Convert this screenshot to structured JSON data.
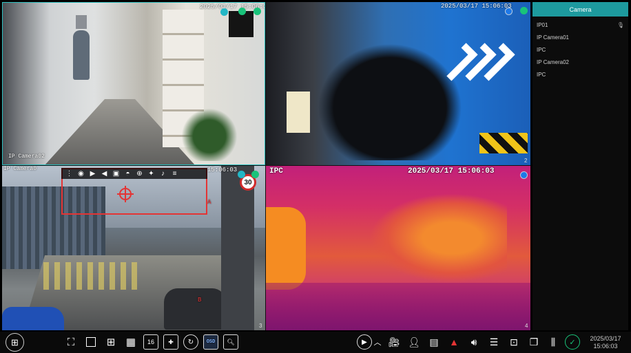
{
  "channels": [
    {
      "id": 1,
      "name": "IP Camera02",
      "timestamp": "2025/03/17 15:06:03",
      "number": ""
    },
    {
      "id": 2,
      "name": "",
      "timestamp": "2025/03/17 15:06:03",
      "number": "2"
    },
    {
      "id": 3,
      "name": "IP Camera0",
      "timestamp": "15:06:03",
      "number": "3"
    },
    {
      "id": 4,
      "name": "IPC",
      "timestamp": "2025/03/17 15:06:03",
      "number": "4"
    }
  ],
  "scene_text": {
    "speed_sign": "30",
    "lane_a": "A",
    "lane_b": "B"
  },
  "channel_toolbar": {
    "icons": [
      "drag-handle-icon",
      "record-icon",
      "play-icon",
      "mute-icon",
      "snapshot-icon",
      "fisheye-icon",
      "zoom-icon",
      "ptz-icon",
      "talk-icon",
      "stream-icon"
    ]
  },
  "camera_panel": {
    "title": "Camera",
    "items": [
      {
        "label": "IP01",
        "has_mic": true
      },
      {
        "label": "IP Camera01",
        "has_mic": false
      },
      {
        "label": "IPC",
        "has_mic": false
      },
      {
        "label": "IP Camera02",
        "has_mic": false
      },
      {
        "label": "IPC",
        "has_mic": false
      }
    ]
  },
  "bottom_bar": {
    "layout_buttons": [
      "full-screen",
      "1-split",
      "4-split",
      "9-split",
      "16-split",
      "custom-layout",
      "sequence"
    ],
    "osd_label": "OSD",
    "date": "2025/03/17",
    "time": "15:06:03"
  },
  "colors": {
    "accent": "#1d9a9e",
    "selected_border": "#2fc3c3",
    "alarm_red": "#e43434",
    "status_green": "#19c37a",
    "status_blue": "#1d78e8"
  }
}
